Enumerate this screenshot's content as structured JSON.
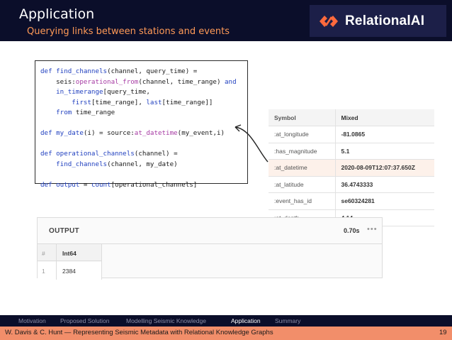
{
  "header": {
    "title": "Application",
    "subtitle": "Querying links between stations and events",
    "logo_text": "RelationalAI"
  },
  "code": {
    "lines": [
      [
        {
          "t": "def ",
          "c": "kw"
        },
        {
          "t": "find_channels",
          "c": "fn"
        },
        {
          "t": "(channel, query_time) =",
          "c": ""
        }
      ],
      [
        {
          "t": "    seis:",
          "c": ""
        },
        {
          "t": "operational_from",
          "c": "mg"
        },
        {
          "t": "(channel, time_range) ",
          "c": ""
        },
        {
          "t": "and",
          "c": "kw"
        }
      ],
      [
        {
          "t": "    ",
          "c": ""
        },
        {
          "t": "in_timerange",
          "c": "fn"
        },
        {
          "t": "[query_time,",
          "c": ""
        }
      ],
      [
        {
          "t": "        ",
          "c": ""
        },
        {
          "t": "first",
          "c": "fn"
        },
        {
          "t": "[time_range], ",
          "c": ""
        },
        {
          "t": "last",
          "c": "fn"
        },
        {
          "t": "[time_range]]",
          "c": ""
        }
      ],
      [
        {
          "t": "    ",
          "c": ""
        },
        {
          "t": "from",
          "c": "kw"
        },
        {
          "t": " time_range",
          "c": ""
        }
      ],
      [
        {
          "t": "",
          "c": ""
        }
      ],
      [
        {
          "t": "def ",
          "c": "kw"
        },
        {
          "t": "my_date",
          "c": "fn"
        },
        {
          "t": "(i) = source:",
          "c": ""
        },
        {
          "t": "at_datetime",
          "c": "mg"
        },
        {
          "t": "(my_event,i)",
          "c": ""
        }
      ],
      [
        {
          "t": "",
          "c": ""
        }
      ],
      [
        {
          "t": "def ",
          "c": "kw"
        },
        {
          "t": "operational_channels",
          "c": "fn"
        },
        {
          "t": "(channel) =",
          "c": ""
        }
      ],
      [
        {
          "t": "    ",
          "c": ""
        },
        {
          "t": "find_channels",
          "c": "fn"
        },
        {
          "t": "(channel, my_date)",
          "c": ""
        }
      ],
      [
        {
          "t": "",
          "c": ""
        }
      ],
      [
        {
          "t": "def ",
          "c": "kw"
        },
        {
          "t": "output",
          "c": "fn"
        },
        {
          "t": " = ",
          "c": ""
        },
        {
          "t": "count",
          "c": "fn"
        },
        {
          "t": "[operational_channels]",
          "c": ""
        }
      ]
    ]
  },
  "symbol_table": {
    "headers": [
      "Symbol",
      "Mixed"
    ],
    "rows": [
      {
        "symbol": ":at_longitude",
        "value": "-81.0865"
      },
      {
        "symbol": ":has_magnitude",
        "value": "5.1"
      },
      {
        "symbol": ":at_datetime",
        "value": "2020-08-09T12:07:37.650Z",
        "highlight": true
      },
      {
        "symbol": ":at_latitude",
        "value": "36.4743333"
      },
      {
        "symbol": ":event_has_id",
        "value": "se60324281"
      },
      {
        "symbol": ":at_depth",
        "value": "4.14"
      }
    ]
  },
  "output_panel": {
    "label": "OUTPUT",
    "time": "0.70s",
    "more": "•••",
    "col_index": "#",
    "col_type": "Int64",
    "row_index": "1",
    "row_value": "2384"
  },
  "nav": {
    "items": [
      {
        "label": "Motivation",
        "active": false
      },
      {
        "label": "Proposed Solution",
        "active": false
      },
      {
        "label": "Modelling Seismic Knowledge",
        "active": false
      },
      {
        "label": "Application",
        "active": true
      },
      {
        "label": "Summary",
        "active": false
      }
    ]
  },
  "footer": {
    "text": "W. Davis & C. Hunt — Representing Seismic Metadata with Relational Knowledge Graphs",
    "page": "19"
  },
  "colors": {
    "header_bg": "#0b0e2a",
    "subtitle": "#ff9a57",
    "logo_accent": "#ff6a3d",
    "footer_bg": "#f28e6a",
    "highlight_row": "#fdf1ea"
  }
}
